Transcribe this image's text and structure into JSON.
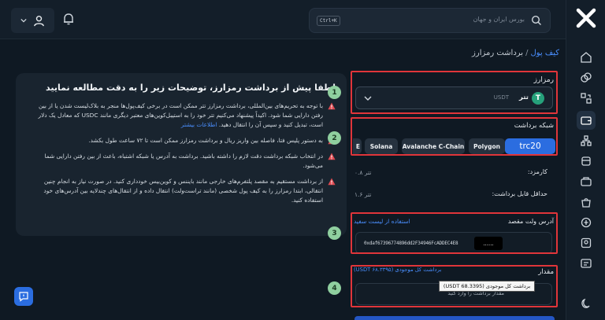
{
  "header": {
    "search_placeholder": "بورس ایران و جهان",
    "search_shortcut": "Ctrl+K"
  },
  "breadcrumb": {
    "link": "کیف پول",
    "separator": "/",
    "current": "برداشت رمزارز"
  },
  "info": {
    "title": "لطفا پیش از برداشت رمزارز، توضیحات زیر را به دقت مطالعه نمایید",
    "paragraphs": [
      {
        "text": "با توجه به تحریم‌های بین‌المللی، برداشت رمزارز تتر ممکن است در برخی کیف‌پول‌ها منجر به بلاک‌لیست شدن یا از بین رفتن دارایی شما شود. اکیداً پیشنهاد می‌کنیم تتر خود را به استیبل‌کوین‌های معتبر دیگری مانند USDC که معادل یک دلار است، تبدیل کنید و سپس آن را انتقال دهید.",
        "more": "اطلاعات بیشتر"
      },
      {
        "text": "به دستور پلیس فتا، فاصله بین واریز ریال و برداشت رمزارز ممکن است تا ۷۲ ساعت طول بکشد."
      },
      {
        "text": "در انتخاب شبکه برداشت دقت لازم را داشته باشید. برداشت به آدرس یا شبکه اشتباه، باعث از بین رفتن دارایی شما می‌شود."
      },
      {
        "text": "از برداشت مستقیم به مقصد پلتفرم‌های خارجی مانند بایننس و کوین‌بیس خودداری کنید. در صورت نیاز به انجام چنین انتقالی، ابتدا رمزارز را به کیف پول شخصی (مانند تراست‌ولت) انتقال داده و از انتقال‌های چندلایه بین آدرس‌های خود استفاده کنید."
      }
    ]
  },
  "form": {
    "coin_label": "رمزارز",
    "coin": {
      "name": "تتر",
      "symbol": "USDT",
      "badge": "T"
    },
    "network_label": "شبکه برداشت",
    "networks": [
      {
        "label": "trc20",
        "active": true
      },
      {
        "label": "Polygon",
        "active": false
      },
      {
        "label": "Avalanche C-Chain",
        "active": false
      },
      {
        "label": "Solana",
        "active": false
      },
      {
        "label": "E",
        "active": false
      }
    ],
    "fee_label": "کارمزد:",
    "fee_value": "۰.۸ تتر",
    "min_label": "حداقل قابل برداشت:",
    "min_value": "۱.۶ تتر",
    "address_label": "آدرس ولت مقصد",
    "address_link": "استفاده از لیست سفید",
    "address_value": "0xdaf67396774896dd2F34946FcADDEC4E8",
    "address_tip": "......",
    "amount_label": "مقدار",
    "amount_link": "برداشت کل موجودی (USDT ۶۸.۳۳۹۵)",
    "amount_placeholder": "مقدار برداشت را وارد کنید",
    "tooltip": "برداشت کل موجودی (USDT 68.3395)"
  },
  "steps": [
    "1",
    "2",
    "3",
    "4"
  ],
  "colors": {
    "accent": "#2b6de0",
    "annotation": "#e0353a",
    "tether": "#26a17b"
  }
}
